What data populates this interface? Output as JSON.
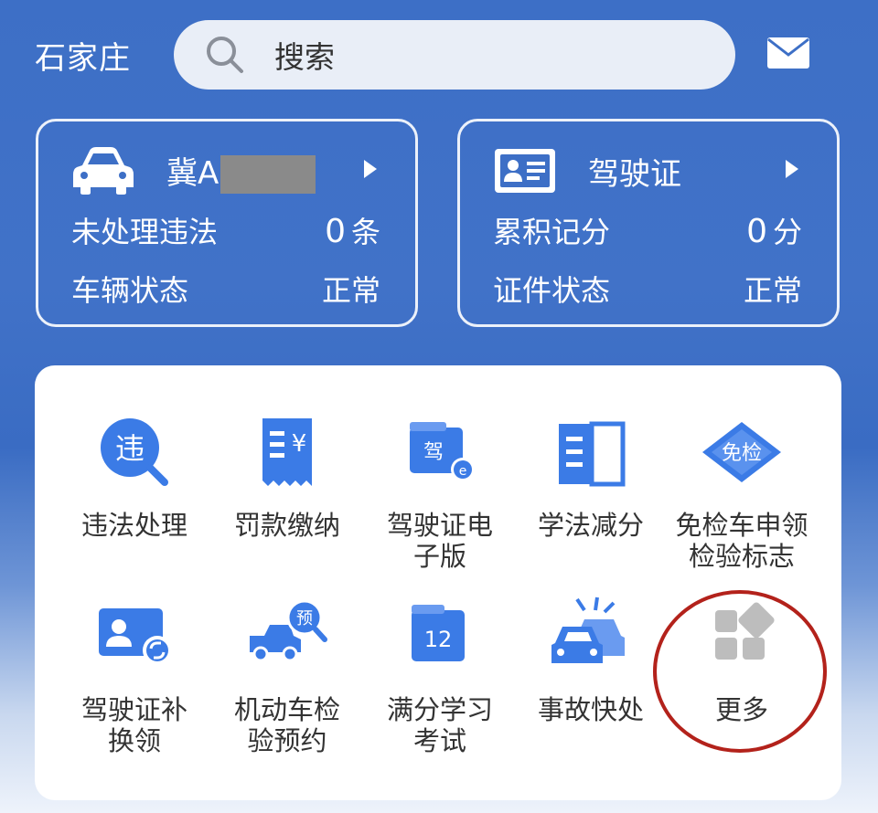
{
  "header": {
    "city": "石家庄",
    "search_placeholder": "搜索",
    "icons": {
      "search": "search-icon",
      "mail": "mail-icon"
    }
  },
  "vehicle_card": {
    "icon": "car-icon",
    "plate_visible": "冀A",
    "plate_masked": true,
    "row1_label": "未处理违法",
    "row1_value": "0",
    "row1_unit": "条",
    "row2_label": "车辆状态",
    "row2_value": "正常"
  },
  "license_card": {
    "icon": "id-card-icon",
    "title": "驾驶证",
    "row1_label": "累积记分",
    "row1_value": "0",
    "row1_unit": "分",
    "row2_label": "证件状态",
    "row2_value": "正常"
  },
  "services": {
    "items": [
      {
        "label": "违法处理",
        "icon": "violation-icon",
        "glyph": "违"
      },
      {
        "label": "罚款缴纳",
        "icon": "receipt-icon",
        "glyph": "¥"
      },
      {
        "label": "驾驶证电子版",
        "label1": "驾驶证电",
        "label2": "子版",
        "icon": "e-license-icon",
        "glyph": "驾"
      },
      {
        "label": "学法减分",
        "icon": "book-icon"
      },
      {
        "label": "免检车申领检验标志",
        "label1": "免检车申领",
        "label2": "检验标志",
        "icon": "exempt-icon",
        "glyph": "免检"
      },
      {
        "label": "驾驶证补换领",
        "label1": "驾驶证补",
        "label2": "换领",
        "icon": "license-replace-icon"
      },
      {
        "label": "机动车检验预约",
        "label1": "机动车检",
        "label2": "验预约",
        "icon": "inspection-booking-icon",
        "glyph": "预"
      },
      {
        "label": "满分学习考试",
        "label1": "满分学习",
        "label2": "考试",
        "icon": "calendar-icon",
        "glyph": "12"
      },
      {
        "label": "事故快处",
        "icon": "accident-icon"
      },
      {
        "label": "更多",
        "icon": "more-grid-icon"
      }
    ]
  },
  "colors": {
    "primary_blue": "#3d6fc6",
    "icon_blue": "#3b7be6",
    "highlight_circle": "#b3221b"
  }
}
